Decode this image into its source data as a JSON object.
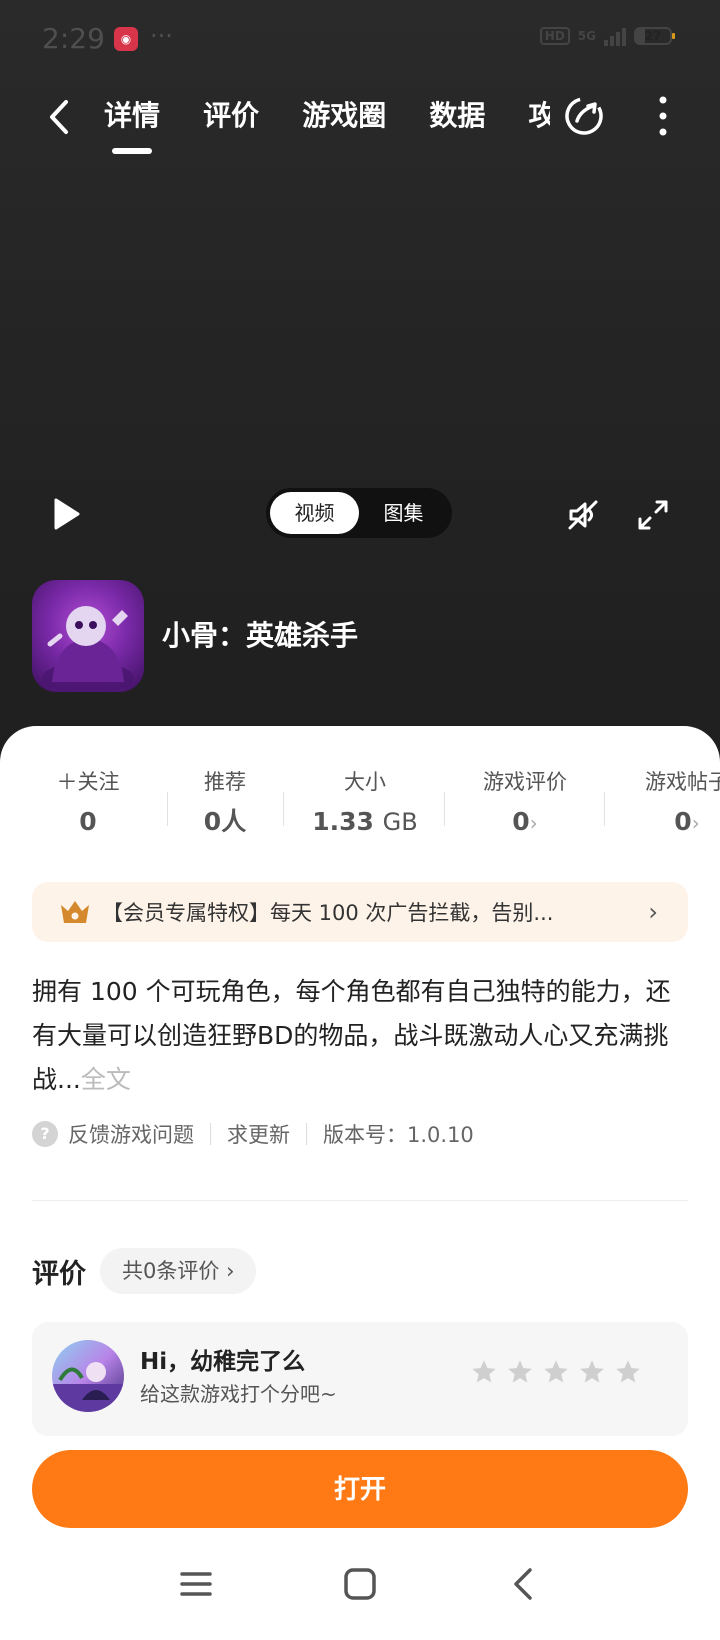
{
  "status_bar": {
    "time": "2:29",
    "dots": "···",
    "hd": "HD",
    "network": "5G",
    "battery": "27"
  },
  "nav": {
    "tabs": [
      {
        "label": "详情",
        "active": true
      },
      {
        "label": "评价"
      },
      {
        "label": "游戏圈"
      },
      {
        "label": "数据"
      },
      {
        "label": "攻略"
      }
    ]
  },
  "media": {
    "video_label": "视频",
    "gallery_label": "图集"
  },
  "game": {
    "title": "小骨：英雄杀手"
  },
  "stats": {
    "follow": {
      "label": "关注",
      "value": "0"
    },
    "recommend": {
      "label": "推荐",
      "value": "0人"
    },
    "size": {
      "label": "大小",
      "value": "1.33",
      "unit": "GB"
    },
    "ratings": {
      "label": "游戏评价",
      "value": "0"
    },
    "posts": {
      "label": "游戏帖子",
      "value": "0"
    }
  },
  "vip_banner": {
    "text": "【会员专属特权】每天 100 次广告拦截，告别..."
  },
  "description": {
    "text": "拥有 100 个可玩角色，每个角色都有自己独特的能力，还有大量可以创造狂野BD的物品，战斗既激动人心又充满挑战...",
    "more": "全文"
  },
  "meta": {
    "feedback": "反馈游戏问题",
    "request_update": "求更新",
    "version": "版本号：1.0.10"
  },
  "reviews": {
    "title": "评价",
    "count": "共0条评价",
    "greeting": "Hi，幼稚完了么",
    "prompt": "给这款游戏打个分吧~",
    "rating": 0,
    "max_rating": 5
  },
  "actions": {
    "open_label": "打开"
  },
  "colors": {
    "accent": "#ff7a14",
    "vip_bg": "#fdf3e9",
    "vip_icon": "#d48a2c"
  }
}
